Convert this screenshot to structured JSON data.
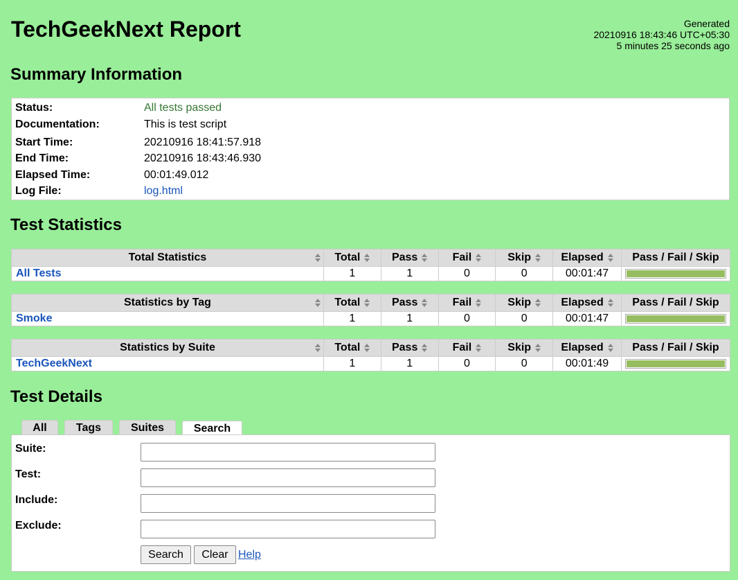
{
  "header": {
    "title": "TechGeekNext Report",
    "generated_label": "Generated",
    "generated_time": "20210916 18:43:46 UTC+05:30",
    "generated_ago": "5 minutes 25 seconds ago"
  },
  "summary": {
    "heading": "Summary Information",
    "rows": [
      {
        "key": "Status:",
        "value": "All tests passed"
      },
      {
        "key": "Documentation:",
        "value": "This is test script"
      },
      {
        "key": "Start Time:",
        "value": "20210916 18:41:57.918"
      },
      {
        "key": "End Time:",
        "value": "20210916 18:43:46.930"
      },
      {
        "key": "Elapsed Time:",
        "value": "00:01:49.012"
      },
      {
        "key": "Log File:",
        "value": "log.html"
      }
    ]
  },
  "statistics": {
    "heading": "Test Statistics",
    "columns": [
      "Total",
      "Pass",
      "Fail",
      "Skip",
      "Elapsed",
      "Pass / Fail / Skip"
    ],
    "tables": [
      {
        "title": "Total Statistics",
        "row": {
          "name": "All Tests",
          "total": "1",
          "pass": "1",
          "fail": "0",
          "skip": "0",
          "elapsed": "00:01:47"
        }
      },
      {
        "title": "Statistics by Tag",
        "row": {
          "name": "Smoke",
          "total": "1",
          "pass": "1",
          "fail": "0",
          "skip": "0",
          "elapsed": "00:01:47"
        }
      },
      {
        "title": "Statistics by Suite",
        "row": {
          "name": "TechGeekNext",
          "total": "1",
          "pass": "1",
          "fail": "0",
          "skip": "0",
          "elapsed": "00:01:49"
        }
      }
    ],
    "bar_pass_fraction": 1.0,
    "bar_color": "#97bd61"
  },
  "details": {
    "heading": "Test Details",
    "tabs": [
      "All",
      "Tags",
      "Suites",
      "Search"
    ],
    "active_tab": "Search",
    "fields": [
      {
        "label": "Suite:",
        "value": ""
      },
      {
        "label": "Test:",
        "value": ""
      },
      {
        "label": "Include:",
        "value": ""
      },
      {
        "label": "Exclude:",
        "value": ""
      }
    ],
    "search_button": "Search",
    "clear_button": "Clear",
    "help_link": "Help"
  },
  "colors": {
    "background": "#99ee99",
    "pass_text": "#337733",
    "link": "#1a55bb"
  }
}
